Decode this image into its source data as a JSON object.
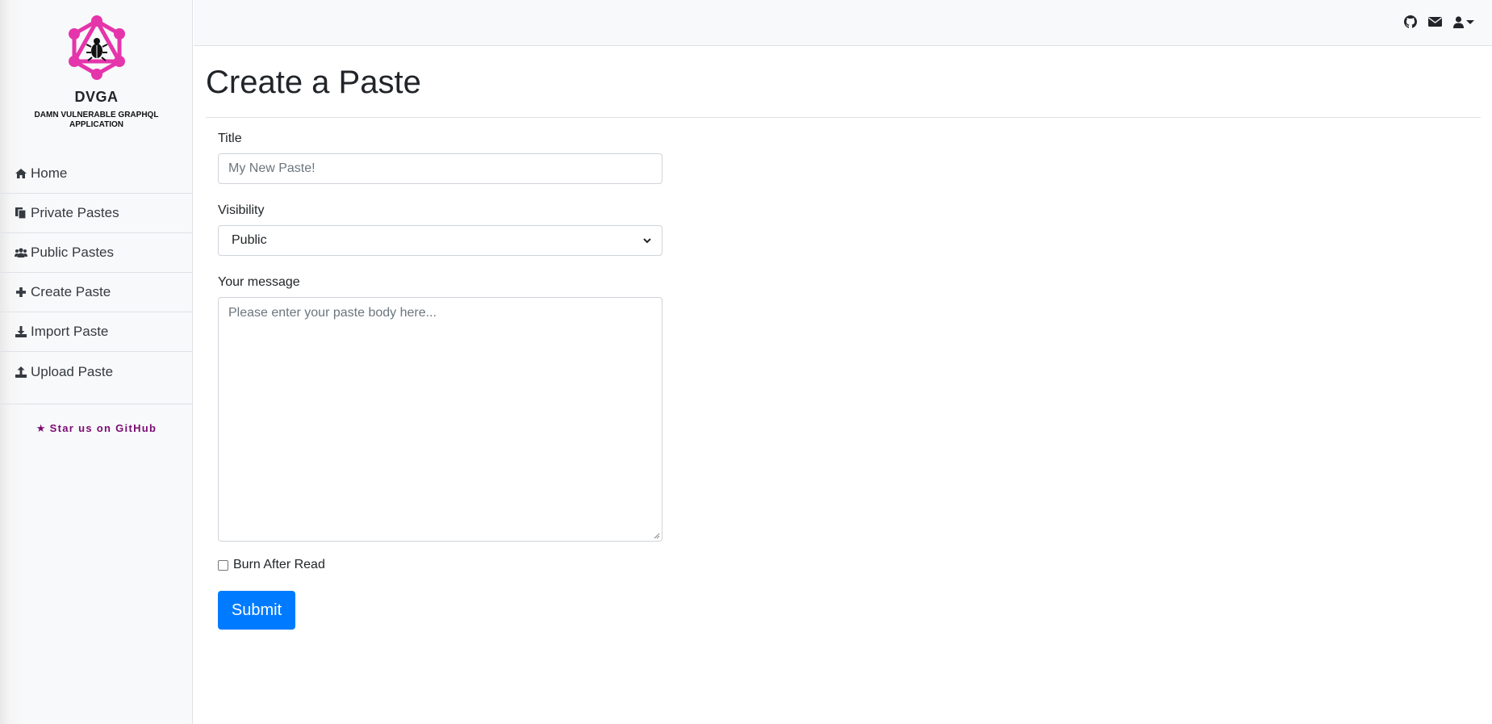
{
  "brand": {
    "name": "DVGA",
    "subtitle": "DAMN VULNERABLE GRAPHQL APPLICATION",
    "logo_icon": "graphql-bug-logo",
    "accent_color": "#e535ab"
  },
  "sidebar": {
    "items": [
      {
        "label": "Home",
        "icon": "home-icon"
      },
      {
        "label": "Private Pastes",
        "icon": "copy-icon"
      },
      {
        "label": "Public Pastes",
        "icon": "users-icon"
      },
      {
        "label": "Create Paste",
        "icon": "plus-icon"
      },
      {
        "label": "Import Paste",
        "icon": "download-icon"
      },
      {
        "label": "Upload Paste",
        "icon": "upload-icon"
      }
    ],
    "star_link": "Star us on GitHub",
    "star_color": "#7b0a73"
  },
  "topbar": {
    "icons": [
      "github-icon",
      "envelope-icon",
      "user-icon"
    ]
  },
  "page": {
    "title": "Create a Paste"
  },
  "form": {
    "title_label": "Title",
    "title_placeholder": "My New Paste!",
    "visibility_label": "Visibility",
    "visibility_selected": "Public",
    "message_label": "Your message",
    "message_placeholder": "Please enter your paste body here...",
    "burn_label": "Burn After Read",
    "submit_label": "Submit",
    "submit_color": "#007bff"
  }
}
